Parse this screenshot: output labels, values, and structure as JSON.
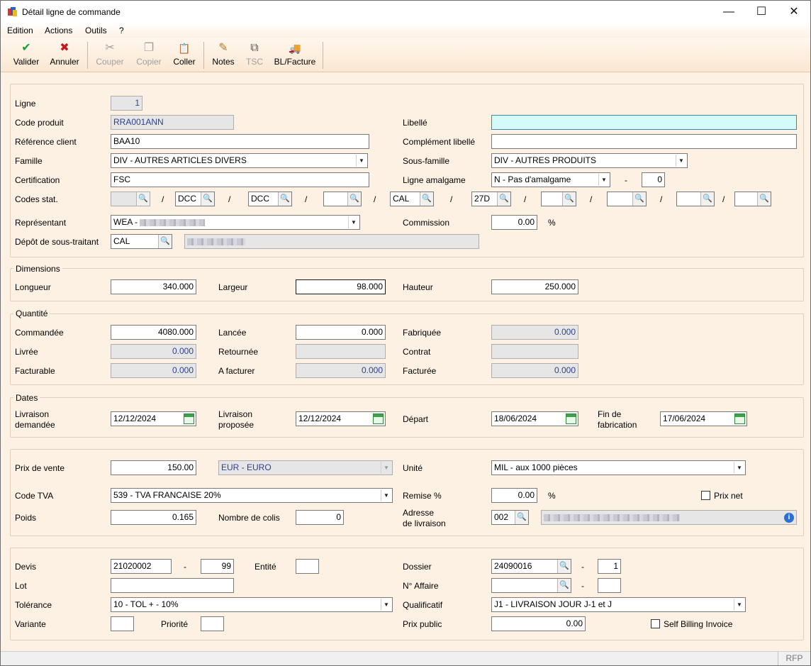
{
  "window": {
    "title": "Détail ligne de commande",
    "minimize": "—",
    "maximize": "☐",
    "close": "✕"
  },
  "menu": [
    "Edition",
    "Actions",
    "Outils",
    "?"
  ],
  "toolbar": {
    "valider": "Valider",
    "annuler": "Annuler",
    "couper": "Couper",
    "copier": "Copier",
    "coller": "Coller",
    "notes": "Notes",
    "tsc": "TSC",
    "bl_facture": "BL/Facture"
  },
  "icons": {
    "check": "✔",
    "cross": "✖",
    "scissors": "✂",
    "copy": "❐",
    "paste": "📋",
    "notes": "✎",
    "tsc": "⧉",
    "truck": "🚚",
    "lookup": "🔍",
    "dropdown": "▼",
    "info": "i"
  },
  "general": {
    "ligne_label": "Ligne",
    "ligne_value": "1",
    "code_produit_label": "Code produit",
    "code_produit_value": "RRA001ANN",
    "libelle_label": "Libellé",
    "libelle_value": "",
    "ref_client_label": "Référence client",
    "ref_client_value": "BAA10",
    "complement_label": "Complément libellé",
    "complement_value": "",
    "famille_label": "Famille",
    "famille_value": "DIV - AUTRES ARTICLES DIVERS",
    "sous_famille_label": "Sous-famille",
    "sous_famille_value": "DIV - AUTRES PRODUITS",
    "certification_label": "Certification",
    "certification_value": "FSC",
    "ligne_amalgame_label": "Ligne amalgame",
    "ligne_amalgame_value": "N - Pas d'amalgame",
    "amalgame_dash": "-",
    "amalgame_num": "0",
    "codes_stat_label": "Codes stat.",
    "codes_stat": [
      "",
      "DCC",
      "DCC",
      "",
      "CAL",
      "27D",
      "",
      "",
      "",
      ""
    ],
    "slash": "/",
    "representant_label": "Représentant",
    "representant_value": "WEA - ",
    "commission_label": "Commission",
    "commission_value": "0.00",
    "percent": "%",
    "depot_label": "Dépôt de sous-traitant",
    "depot_value": "CAL"
  },
  "dimensions": {
    "title": "Dimensions",
    "longueur_label": "Longueur",
    "longueur_value": "340.000",
    "largeur_label": "Largeur",
    "largeur_value": "98.000",
    "hauteur_label": "Hauteur",
    "hauteur_value": "250.000"
  },
  "quantite": {
    "title": "Quantité",
    "commandee_label": "Commandée",
    "commandee_value": "4080.000",
    "lancee_label": "Lancée",
    "lancee_value": "0.000",
    "fabriquee_label": "Fabriquée",
    "fabriquee_value": "0.000",
    "livree_label": "Livrée",
    "livree_value": "0.000",
    "retournee_label": "Retournée",
    "retournee_value": "",
    "contrat_label": "Contrat",
    "contrat_value": "",
    "facturable_label": "Facturable",
    "facturable_value": "0.000",
    "afacturer_label": "A facturer",
    "afacturer_value": "0.000",
    "facturee_label": "Facturée",
    "facturee_value": "0.000"
  },
  "dates": {
    "title": "Dates",
    "livraison_demandee_l1": "Livraison",
    "livraison_demandee_l2": "demandée",
    "livraison_demandee_value": "12/12/2024",
    "livraison_proposee_l1": "Livraison",
    "livraison_proposee_l2": "proposée",
    "livraison_proposee_value": "12/12/2024",
    "depart_label": "Départ",
    "depart_value": "18/06/2024",
    "fin_fab_l1": "Fin de",
    "fin_fab_l2": "fabrication",
    "fin_fab_value": "17/06/2024"
  },
  "prix": {
    "prix_vente_label": "Prix de vente",
    "prix_vente_value": "150.00",
    "devise_value": "EUR - EURO",
    "unite_label": "Unité",
    "unite_value": "MIL - aux 1000 pièces",
    "code_tva_label": "Code TVA",
    "code_tva_value": "539 - TVA FRANCAISE 20%",
    "remise_label": "Remise %",
    "remise_value": "0.00",
    "percent": "%",
    "prix_net_label": "Prix net",
    "poids_label": "Poids",
    "poids_value": "0.165",
    "nb_colis_label": "Nombre de colis",
    "nb_colis_value": "0",
    "adresse_l1": "Adresse",
    "adresse_l2": "de livraison",
    "adresse_value": "002"
  },
  "divers": {
    "devis_label": "Devis",
    "devis_value": "21020002",
    "devis_dash": "-",
    "devis_num": "99",
    "entite_label": "Entité",
    "entite_value": "",
    "dossier_label": "Dossier",
    "dossier_value": "24090016",
    "dossier_dash": "-",
    "dossier_num": "1",
    "lot_label": "Lot",
    "lot_value": "",
    "affaire_label": "N° Affaire",
    "affaire_value": "",
    "affaire_dash": "-",
    "affaire_num": "",
    "tolerance_label": "Tolérance",
    "tolerance_value": "10 - TOL + - 10%",
    "qualificatif_label": "Qualificatif",
    "qualificatif_value": "J1 - LIVRAISON JOUR J-1 et J",
    "variante_label": "Variante",
    "variante_value": "",
    "priorite_label": "Priorité",
    "priorite_value": "",
    "prix_public_label": "Prix public",
    "prix_public_value": "0.00",
    "self_billing_label": "Self Billing Invoice"
  },
  "status": {
    "rfp": "RFP"
  }
}
